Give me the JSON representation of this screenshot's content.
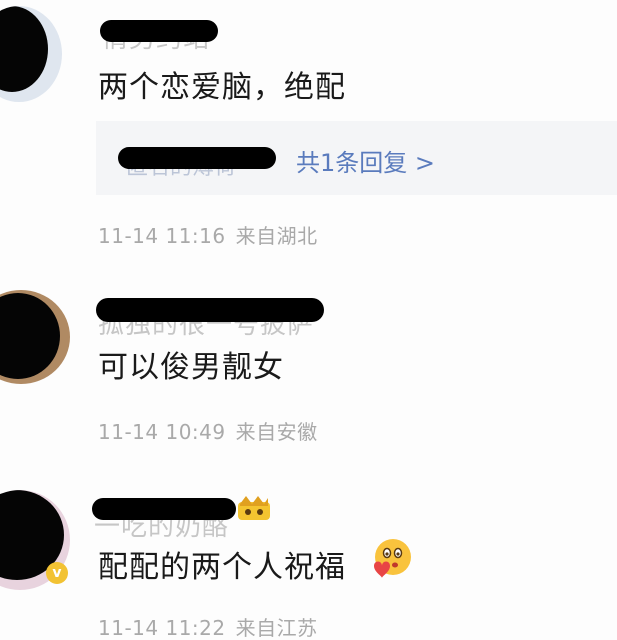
{
  "comments": [
    {
      "username": "情男约站",
      "text": "两个恋爱脑，绝配",
      "reply": {
        "replier": "匿名的薄荷",
        "link_label": "共1条回复 >"
      },
      "time": "11-14 11:16",
      "location": "来自湖北"
    },
    {
      "username": "孤独的很一号披萨",
      "text": "可以俊男靓女",
      "time": "11-14 10:49",
      "location": "来自安徽"
    },
    {
      "username": "一吃的奶酪",
      "text": "配配的两个人祝福",
      "time": "11-14 11:22",
      "location": "来自江苏"
    }
  ],
  "icons": {
    "crown": "crown-emoji-icon",
    "face": "love-face-emoji-icon",
    "verified": "verified-badge-icon"
  },
  "colors": {
    "reply_link": "#5a7bbd",
    "meta_text": "#a9a9a9",
    "reply_bg": "#f4f5f7",
    "redaction": "#000000"
  }
}
